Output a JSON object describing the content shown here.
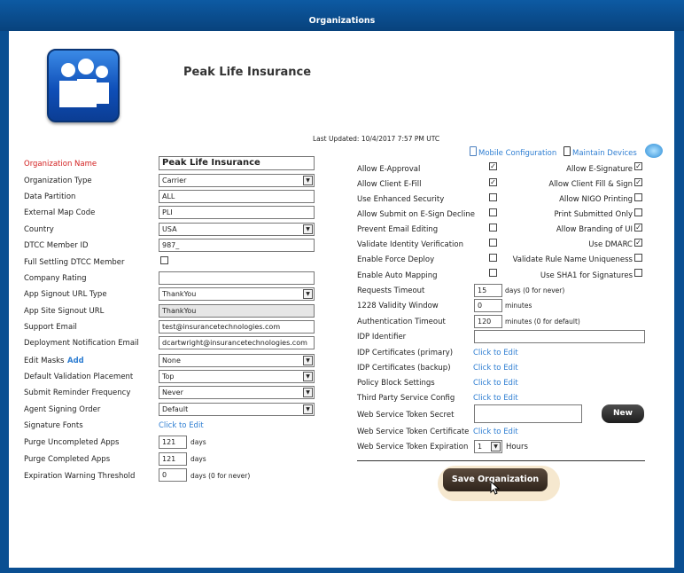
{
  "window": {
    "title": "Organizations"
  },
  "header": {
    "org_name": "Peak Life Insurance",
    "last_updated": "Last Updated: 10/4/2017 7:57 PM UTC",
    "mobile_config": "Mobile Configuration",
    "maintain_devices": "Maintain Devices"
  },
  "left": {
    "org_name_label": "Organization Name",
    "org_name_value": "Peak Life Insurance",
    "org_type_label": "Organization Type",
    "org_type_value": "Carrier",
    "data_partition_label": "Data Partition",
    "data_partition_value": "ALL",
    "ext_map_label": "External Map Code",
    "ext_map_value": "PLI",
    "country_label": "Country",
    "country_value": "USA",
    "dtcc_id_label": "DTCC Member ID",
    "dtcc_id_value": "987_",
    "full_dtcc_label": "Full Settling DTCC Member",
    "company_rating_label": "Company Rating",
    "company_rating_value": "",
    "signout_type_label": "App Signout URL Type",
    "signout_type_value": "ThankYou",
    "signout_url_label": "App Site Signout URL",
    "signout_url_value": "ThankYou",
    "support_email_label": "Support Email",
    "support_email_value": "test@insurancetechnologies.com",
    "deploy_email_label": "Deployment Notification Email",
    "deploy_email_value": "dcartwright@insurancetechnologies.com",
    "edit_masks_label": "Edit Masks",
    "edit_masks_add": "Add",
    "edit_masks_value": "None",
    "validation_label": "Default Validation Placement",
    "validation_value": "Top",
    "reminder_label": "Submit Reminder Frequency",
    "reminder_value": "Never",
    "agent_order_label": "Agent Signing Order",
    "agent_order_value": "Default",
    "sig_fonts_label": "Signature Fonts",
    "sig_fonts_link": "Click to Edit",
    "purge_uncompleted_label": "Purge Uncompleted Apps",
    "purge_uncompleted_value": "121",
    "purge_completed_label": "Purge Completed Apps",
    "purge_completed_value": "121",
    "expiration_label": "Expiration Warning Threshold",
    "expiration_value": "0",
    "days": "days",
    "days_never": "days (0 for never)"
  },
  "right": {
    "checks": {
      "allow_eapproval": {
        "label": "Allow E-Approval",
        "checked": true
      },
      "allow_client_efill": {
        "label": "Allow Client E-Fill",
        "checked": true
      },
      "use_enhanced_security": {
        "label": "Use Enhanced Security",
        "checked": false
      },
      "allow_submit_decline": {
        "label": "Allow Submit on E-Sign Decline",
        "checked": false
      },
      "prevent_email_editing": {
        "label": "Prevent Email Editing",
        "checked": false
      },
      "validate_identity": {
        "label": "Validate Identity Verification",
        "checked": false
      },
      "enable_force_deploy": {
        "label": "Enable Force Deploy",
        "checked": false
      },
      "enable_auto_mapping": {
        "label": "Enable Auto Mapping",
        "checked": false
      },
      "allow_esignature": {
        "label": "Allow E-Signature",
        "checked": true
      },
      "allow_client_fill_sign": {
        "label": "Allow Client Fill & Sign",
        "checked": true
      },
      "allow_nigo_printing": {
        "label": "Allow NIGO Printing",
        "checked": false
      },
      "print_submitted_only": {
        "label": "Print Submitted Only",
        "checked": false
      },
      "allow_branding": {
        "label": "Allow Branding of UI",
        "checked": true
      },
      "use_dmarc": {
        "label": "Use DMARC",
        "checked": true
      },
      "validate_rule_name": {
        "label": "Validate Rule Name Uniqueness",
        "checked": false
      },
      "use_sha1": {
        "label": "Use SHA1 for Signatures",
        "checked": false
      }
    },
    "requests_timeout_label": "Requests Timeout",
    "requests_timeout_value": "15",
    "requests_timeout_unit": "days (0 for never)",
    "validity_label": "1228 Validity Window",
    "validity_value": "0",
    "validity_unit": "minutes",
    "auth_timeout_label": "Authentication Timeout",
    "auth_timeout_value": "120",
    "auth_timeout_unit": "minutes (0 for default)",
    "idp_identifier_label": "IDP Identifier",
    "idp_identifier_value": "",
    "idp_primary_label": "IDP Certificates (primary)",
    "idp_backup_label": "IDP Certificates (backup)",
    "policy_block_label": "Policy Block Settings",
    "third_party_label": "Third Party Service Config",
    "click_to_edit": "Click to Edit",
    "ws_secret_label": "Web Service Token Secret",
    "ws_secret_value": "",
    "new_button": "New",
    "ws_cert_label": "Web Service Token Certificate",
    "ws_expiration_label": "Web Service Token Expiration",
    "ws_expiration_value": "1",
    "hours": "Hours"
  },
  "footer": {
    "save_button": "Save Organization"
  },
  "colors": {
    "title_bar": "#0a4f92",
    "link": "#2e7ed2",
    "required_label": "#d21e1e"
  }
}
